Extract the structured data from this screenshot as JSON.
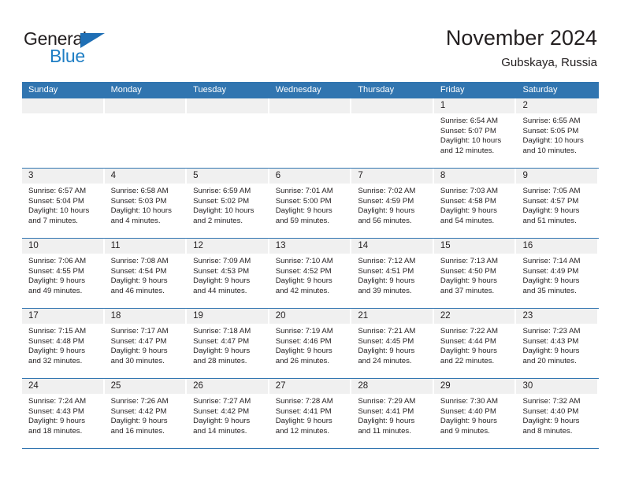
{
  "brand": {
    "name_top": "General",
    "name_bottom": "Blue",
    "accent_color": "#1f7ec4",
    "triangle_icon": "triangle-icon"
  },
  "header": {
    "title": "November 2024",
    "subtitle": "Gubskaya, Russia",
    "header_bg_color": "#3175b0",
    "header_text_color": "#ffffff"
  },
  "calendar": {
    "weekdays": [
      "Sunday",
      "Monday",
      "Tuesday",
      "Wednesday",
      "Thursday",
      "Friday",
      "Saturday"
    ],
    "labels": {
      "sunrise": "Sunrise:",
      "sunset": "Sunset:",
      "daylight": "Daylight:"
    },
    "weeks": [
      [
        {
          "day": "",
          "empty": true
        },
        {
          "day": "",
          "empty": true
        },
        {
          "day": "",
          "empty": true
        },
        {
          "day": "",
          "empty": true
        },
        {
          "day": "",
          "empty": true
        },
        {
          "day": "1",
          "sunrise": "Sunrise: 6:54 AM",
          "sunset": "Sunset: 5:07 PM",
          "daylight_1": "Daylight: 10 hours",
          "daylight_2": "and 12 minutes."
        },
        {
          "day": "2",
          "sunrise": "Sunrise: 6:55 AM",
          "sunset": "Sunset: 5:05 PM",
          "daylight_1": "Daylight: 10 hours",
          "daylight_2": "and 10 minutes."
        }
      ],
      [
        {
          "day": "3",
          "sunrise": "Sunrise: 6:57 AM",
          "sunset": "Sunset: 5:04 PM",
          "daylight_1": "Daylight: 10 hours",
          "daylight_2": "and 7 minutes."
        },
        {
          "day": "4",
          "sunrise": "Sunrise: 6:58 AM",
          "sunset": "Sunset: 5:03 PM",
          "daylight_1": "Daylight: 10 hours",
          "daylight_2": "and 4 minutes."
        },
        {
          "day": "5",
          "sunrise": "Sunrise: 6:59 AM",
          "sunset": "Sunset: 5:02 PM",
          "daylight_1": "Daylight: 10 hours",
          "daylight_2": "and 2 minutes."
        },
        {
          "day": "6",
          "sunrise": "Sunrise: 7:01 AM",
          "sunset": "Sunset: 5:00 PM",
          "daylight_1": "Daylight: 9 hours",
          "daylight_2": "and 59 minutes."
        },
        {
          "day": "7",
          "sunrise": "Sunrise: 7:02 AM",
          "sunset": "Sunset: 4:59 PM",
          "daylight_1": "Daylight: 9 hours",
          "daylight_2": "and 56 minutes."
        },
        {
          "day": "8",
          "sunrise": "Sunrise: 7:03 AM",
          "sunset": "Sunset: 4:58 PM",
          "daylight_1": "Daylight: 9 hours",
          "daylight_2": "and 54 minutes."
        },
        {
          "day": "9",
          "sunrise": "Sunrise: 7:05 AM",
          "sunset": "Sunset: 4:57 PM",
          "daylight_1": "Daylight: 9 hours",
          "daylight_2": "and 51 minutes."
        }
      ],
      [
        {
          "day": "10",
          "sunrise": "Sunrise: 7:06 AM",
          "sunset": "Sunset: 4:55 PM",
          "daylight_1": "Daylight: 9 hours",
          "daylight_2": "and 49 minutes."
        },
        {
          "day": "11",
          "sunrise": "Sunrise: 7:08 AM",
          "sunset": "Sunset: 4:54 PM",
          "daylight_1": "Daylight: 9 hours",
          "daylight_2": "and 46 minutes."
        },
        {
          "day": "12",
          "sunrise": "Sunrise: 7:09 AM",
          "sunset": "Sunset: 4:53 PM",
          "daylight_1": "Daylight: 9 hours",
          "daylight_2": "and 44 minutes."
        },
        {
          "day": "13",
          "sunrise": "Sunrise: 7:10 AM",
          "sunset": "Sunset: 4:52 PM",
          "daylight_1": "Daylight: 9 hours",
          "daylight_2": "and 42 minutes."
        },
        {
          "day": "14",
          "sunrise": "Sunrise: 7:12 AM",
          "sunset": "Sunset: 4:51 PM",
          "daylight_1": "Daylight: 9 hours",
          "daylight_2": "and 39 minutes."
        },
        {
          "day": "15",
          "sunrise": "Sunrise: 7:13 AM",
          "sunset": "Sunset: 4:50 PM",
          "daylight_1": "Daylight: 9 hours",
          "daylight_2": "and 37 minutes."
        },
        {
          "day": "16",
          "sunrise": "Sunrise: 7:14 AM",
          "sunset": "Sunset: 4:49 PM",
          "daylight_1": "Daylight: 9 hours",
          "daylight_2": "and 35 minutes."
        }
      ],
      [
        {
          "day": "17",
          "sunrise": "Sunrise: 7:15 AM",
          "sunset": "Sunset: 4:48 PM",
          "daylight_1": "Daylight: 9 hours",
          "daylight_2": "and 32 minutes."
        },
        {
          "day": "18",
          "sunrise": "Sunrise: 7:17 AM",
          "sunset": "Sunset: 4:47 PM",
          "daylight_1": "Daylight: 9 hours",
          "daylight_2": "and 30 minutes."
        },
        {
          "day": "19",
          "sunrise": "Sunrise: 7:18 AM",
          "sunset": "Sunset: 4:47 PM",
          "daylight_1": "Daylight: 9 hours",
          "daylight_2": "and 28 minutes."
        },
        {
          "day": "20",
          "sunrise": "Sunrise: 7:19 AM",
          "sunset": "Sunset: 4:46 PM",
          "daylight_1": "Daylight: 9 hours",
          "daylight_2": "and 26 minutes."
        },
        {
          "day": "21",
          "sunrise": "Sunrise: 7:21 AM",
          "sunset": "Sunset: 4:45 PM",
          "daylight_1": "Daylight: 9 hours",
          "daylight_2": "and 24 minutes."
        },
        {
          "day": "22",
          "sunrise": "Sunrise: 7:22 AM",
          "sunset": "Sunset: 4:44 PM",
          "daylight_1": "Daylight: 9 hours",
          "daylight_2": "and 22 minutes."
        },
        {
          "day": "23",
          "sunrise": "Sunrise: 7:23 AM",
          "sunset": "Sunset: 4:43 PM",
          "daylight_1": "Daylight: 9 hours",
          "daylight_2": "and 20 minutes."
        }
      ],
      [
        {
          "day": "24",
          "sunrise": "Sunrise: 7:24 AM",
          "sunset": "Sunset: 4:43 PM",
          "daylight_1": "Daylight: 9 hours",
          "daylight_2": "and 18 minutes."
        },
        {
          "day": "25",
          "sunrise": "Sunrise: 7:26 AM",
          "sunset": "Sunset: 4:42 PM",
          "daylight_1": "Daylight: 9 hours",
          "daylight_2": "and 16 minutes."
        },
        {
          "day": "26",
          "sunrise": "Sunrise: 7:27 AM",
          "sunset": "Sunset: 4:42 PM",
          "daylight_1": "Daylight: 9 hours",
          "daylight_2": "and 14 minutes."
        },
        {
          "day": "27",
          "sunrise": "Sunrise: 7:28 AM",
          "sunset": "Sunset: 4:41 PM",
          "daylight_1": "Daylight: 9 hours",
          "daylight_2": "and 12 minutes."
        },
        {
          "day": "28",
          "sunrise": "Sunrise: 7:29 AM",
          "sunset": "Sunset: 4:41 PM",
          "daylight_1": "Daylight: 9 hours",
          "daylight_2": "and 11 minutes."
        },
        {
          "day": "29",
          "sunrise": "Sunrise: 7:30 AM",
          "sunset": "Sunset: 4:40 PM",
          "daylight_1": "Daylight: 9 hours",
          "daylight_2": "and 9 minutes."
        },
        {
          "day": "30",
          "sunrise": "Sunrise: 7:32 AM",
          "sunset": "Sunset: 4:40 PM",
          "daylight_1": "Daylight: 9 hours",
          "daylight_2": "and 8 minutes."
        }
      ]
    ]
  }
}
